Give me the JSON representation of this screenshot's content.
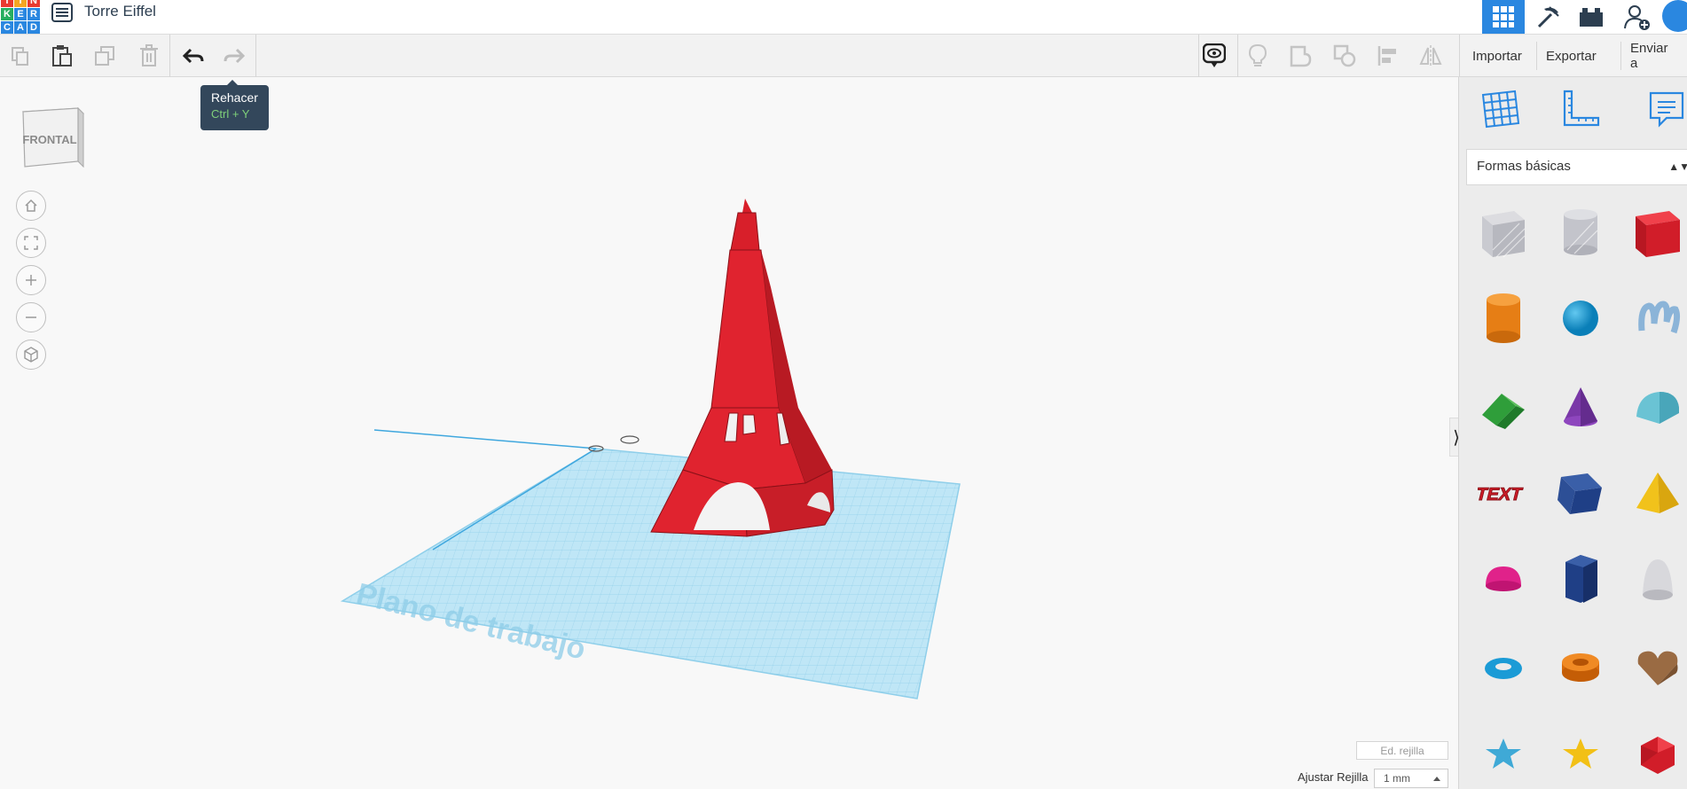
{
  "header": {
    "logo_letters": [
      "T",
      "I",
      "N",
      "K",
      "E",
      "R",
      "C",
      "A",
      "D"
    ],
    "project_title": "Torre Eiffel"
  },
  "toolbar": {
    "import_label": "Importar",
    "export_label": "Exportar",
    "send_label": "Enviar a"
  },
  "tooltip": {
    "title": "Rehacer",
    "shortcut": "Ctrl + Y"
  },
  "viewcube": {
    "face_label": "FRONTAL"
  },
  "workplane": {
    "label": "Plano de trabajo"
  },
  "bottom": {
    "edit_grid_label": "Ed. rejilla",
    "snap_label": "Ajustar Rejilla",
    "snap_value": "1 mm"
  },
  "right_panel": {
    "category_selected": "Formas básicas",
    "shapes": [
      "box",
      "cylinder-hole",
      "box-red",
      "cylinder",
      "sphere",
      "scribble",
      "roof",
      "cone",
      "round-roof",
      "text",
      "prism",
      "pyramid",
      "half-sphere",
      "polygon",
      "paraboloid",
      "torus",
      "tube",
      "heart",
      "star",
      "star-gold",
      "icosahedron"
    ],
    "text_shape_label": "TEXT"
  },
  "colors": {
    "accent": "#2a87e0",
    "model_red": "#e0232f",
    "tooltip_bg": "#33475b",
    "workplane": "#a8d8ee"
  }
}
